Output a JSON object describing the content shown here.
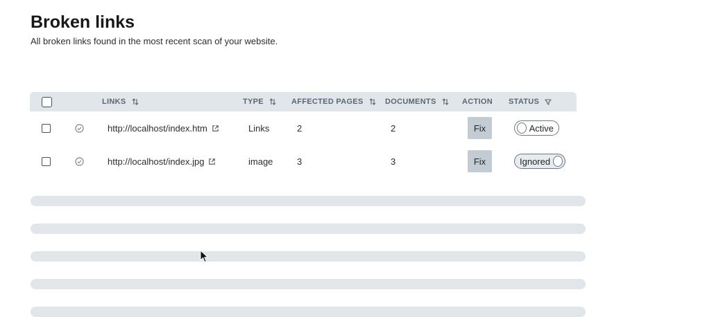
{
  "page": {
    "title": "Broken links",
    "subtitle": "All broken links found in the most recent scan of your website."
  },
  "table": {
    "columns": {
      "links": "LINKS",
      "type": "TYPE",
      "affected_pages": "AFFECTED PAGES",
      "documents": "DOCUMENTS",
      "action": "ACTION",
      "status": "STATUS"
    },
    "rows": [
      {
        "link": "http://localhost/index.htm",
        "type": "Links",
        "affected_pages": "2",
        "documents": "2",
        "action": "Fix",
        "status": "Active"
      },
      {
        "link": "http://localhost/index.jpg",
        "type": "image",
        "affected_pages": "3",
        "documents": "3",
        "action": "Fix",
        "status": "Ignored"
      }
    ]
  },
  "icons": {
    "sort": "sort-icon",
    "filter": "filter-icon",
    "check": "check-circle-icon",
    "external": "external-link-icon"
  },
  "colors": {
    "header_bg": "#e1e6ea",
    "button_bg": "#c3ccd3",
    "skeleton": "#e1e6ea"
  }
}
